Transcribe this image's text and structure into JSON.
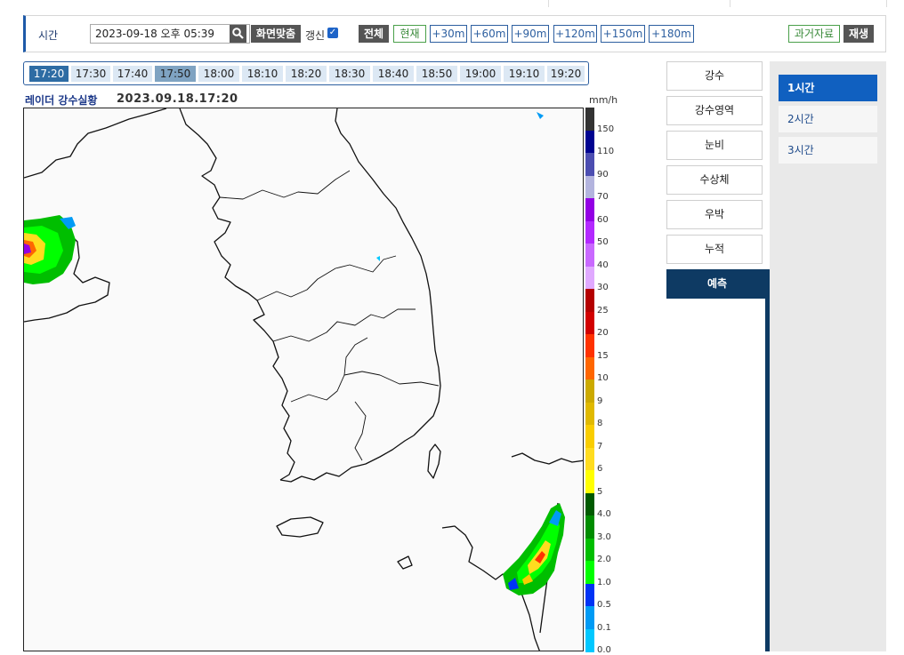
{
  "controls": {
    "time_label": "시간",
    "datetime": "2023-09-18 오후 05:39",
    "fit_label": "화면맞춤",
    "refresh_label": "갱신",
    "refresh_checked": true,
    "all_label": "전체",
    "now_label": "현재",
    "offsets": [
      "+30m",
      "+60m",
      "+90m",
      "+120m",
      "+150m",
      "+180m"
    ],
    "past_label": "과거자료",
    "play_label": "재생"
  },
  "timeline": {
    "items": [
      "17:20",
      "17:30",
      "17:40",
      "17:50",
      "18:00",
      "18:10",
      "18:20",
      "18:30",
      "18:40",
      "18:50",
      "19:00",
      "19:10",
      "19:20"
    ],
    "selected": "17:20",
    "highlighted": "17:50"
  },
  "map": {
    "title": "레이더 강수실황",
    "timestamp": "2023.09.18.17:20",
    "unit": "mm/h"
  },
  "legend": {
    "labels": [
      "150",
      "110",
      "90",
      "70",
      "60",
      "50",
      "40",
      "30",
      "25",
      "20",
      "15",
      "10",
      "9",
      "8",
      "7",
      "6",
      "5",
      "4.0",
      "3.0",
      "2.0",
      "1.0",
      "0.5",
      "0.1",
      "0.0"
    ],
    "colors": [
      "#333333",
      "#000390",
      "#4c4eb1",
      "#b3b4de",
      "#9300e4",
      "#b329ff",
      "#c969ff",
      "#e0a9ff",
      "#b40000",
      "#d20000",
      "#ff3200",
      "#ff6600",
      "#ccaa00",
      "#e0b900",
      "#f9cd00",
      "#ffdc1f",
      "#ffff00",
      "#005a00",
      "#008c00",
      "#00be00",
      "#00ff00",
      "#0033f5",
      "#009bf5",
      "#00c8ff"
    ]
  },
  "menu": {
    "items": [
      "강수",
      "강수영역",
      "눈비",
      "수상체",
      "우박",
      "누적",
      "예측"
    ],
    "active": "예측"
  },
  "subpanel": {
    "items": [
      "1시간",
      "2시간",
      "3시간"
    ],
    "active": "1시간"
  }
}
